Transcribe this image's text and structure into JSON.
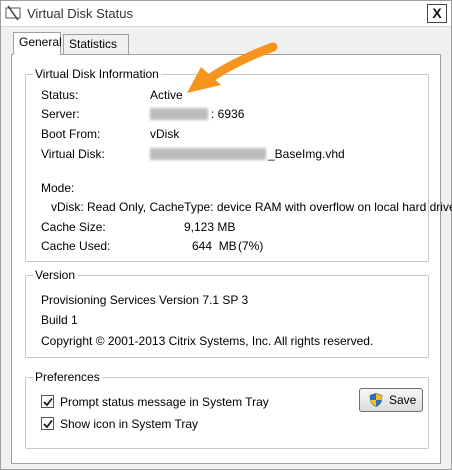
{
  "window": {
    "title": "Virtual Disk Status",
    "close_label": "X"
  },
  "tabs": [
    {
      "label": "General",
      "active": true
    },
    {
      "label": "Statistics",
      "active": false
    }
  ],
  "info": {
    "legend": "Virtual Disk Information",
    "status_label": "Status:",
    "status_value": "Active",
    "server_label": "Server:",
    "server_port": ": 6936",
    "boot_label": "Boot From:",
    "boot_value": "vDisk",
    "vdisk_label": "Virtual Disk:",
    "vdisk_value": "_BaseImg.vhd",
    "mode_label": "Mode:",
    "mode_value": "vDisk: Read Only, CacheType: device RAM with overflow on local hard drive",
    "cache_size_label": "Cache Size:",
    "cache_size_value": "9,123 MB",
    "cache_used_label": "Cache Used:",
    "cache_used_value": "644  MB",
    "cache_used_pct": "(7%)"
  },
  "version": {
    "legend": "Version",
    "product": "Provisioning Services Version 7.1 SP 3",
    "build": "Build 1",
    "copyright": "Copyright © 2001-2013 Citrix Systems, Inc. All rights reserved."
  },
  "preferences": {
    "legend": "Preferences",
    "save_label": "Save",
    "prompt_label": "Prompt status message in System Tray",
    "prompt_checked": true,
    "show_icon_label": "Show icon in System Tray",
    "show_icon_checked": true
  },
  "colors": {
    "annotation_arrow": "#f7941d",
    "shield_blue": "#2f6fc0",
    "shield_gold": "#f2c21b"
  },
  "icons": {
    "title": "window-app-icon",
    "close": "close-icon",
    "save": "uac-shield-icon",
    "checkbox": "check-icon"
  }
}
